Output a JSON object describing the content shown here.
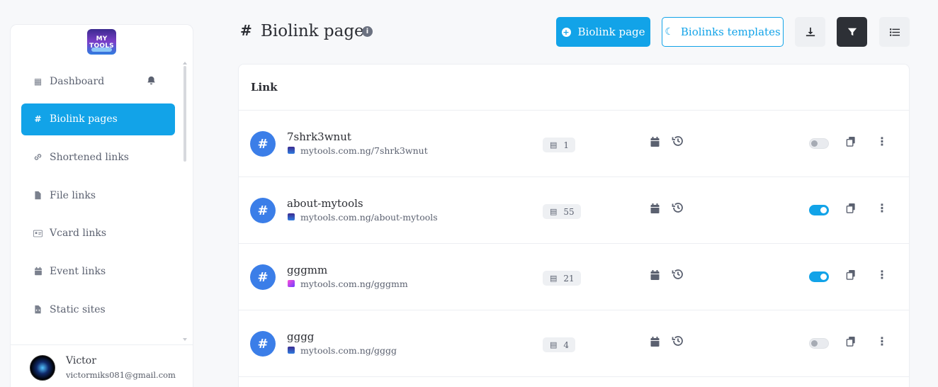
{
  "sidebar": {
    "logo": {
      "text": "MY TOOLS",
      "icon": "mytools-logo"
    },
    "items": [
      {
        "label": "Dashboard",
        "icon": "table-icon",
        "active": false
      },
      {
        "label": "Biolink pages",
        "icon": "hash-icon",
        "active": true
      },
      {
        "label": "Shortened links",
        "icon": "link-icon",
        "active": false
      },
      {
        "label": "File links",
        "icon": "file-icon",
        "active": false
      },
      {
        "label": "Vcard links",
        "icon": "id-card-icon",
        "active": false
      },
      {
        "label": "Event links",
        "icon": "calendar-icon",
        "active": false
      },
      {
        "label": "Static sites",
        "icon": "file-code-icon",
        "active": false
      }
    ],
    "user": {
      "name": "Victor",
      "email": "victormiks081@gmail.com"
    }
  },
  "header": {
    "title": "Biolink pages",
    "buttons": {
      "create": "Biolink page",
      "templates": "Biolinks templates"
    }
  },
  "table": {
    "header": "Link",
    "rows": [
      {
        "name": "7shrk3wnut",
        "url": "mytools.com.ng/7shrk3wnut",
        "stats": "1",
        "enabled": false
      },
      {
        "name": "about-mytools",
        "url": "mytools.com.ng/about-mytools",
        "stats": "55",
        "enabled": true
      },
      {
        "name": "gggmm",
        "url": "mytools.com.ng/gggmm",
        "stats": "21",
        "enabled": true
      },
      {
        "name": "gggg",
        "url": "mytools.com.ng/gggg",
        "stats": "4",
        "enabled": false
      }
    ]
  },
  "colors": {
    "accent": "#12a3e8",
    "badge": "#3b7ee8",
    "dark_button": "#2d3036"
  }
}
